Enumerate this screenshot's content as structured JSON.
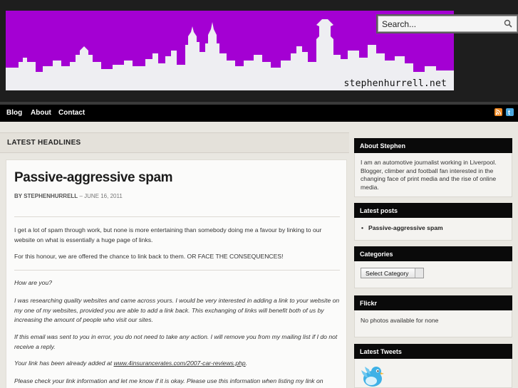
{
  "header": {
    "domain": "stephenhurrell.net",
    "search_placeholder": "Search..."
  },
  "nav": {
    "items": [
      "Blog",
      "About",
      "Contact"
    ]
  },
  "main": {
    "section_title": "LATEST HEADLINES",
    "post": {
      "title": "Passive-aggressive spam",
      "meta_by": "BY STEPHENHURRELL",
      "meta_date": "– JUNE 16, 2011",
      "paragraphs": [
        "I get a lot of spam through work, but none is more entertaining than somebody doing me a favour by linking to our website on what is essentially a huge page of links.",
        "For this honour, we are offered the chance to link back to them. OR FACE THE CONSEQUENCES!"
      ],
      "quote": [
        "How are you?",
        "I was researching quality websites and came across yours. I would be very interested in adding a link to your website on my one of my websites, provided you are able to add a link back. This exchanging of links will benefit both of us by increasing the amount of people who visit our sites.",
        "If this email was sent to you in error, you do not need to take any action. I will remove you from my mailing list if I do not receive a reply.",
        "Please check your link information and let me know if it is okay. Please use this information when listing my link on"
      ],
      "link_line_prefix": "Your link has been already added at ",
      "link_url": "www.4insurancerates.com/2007-car-reviews.php",
      "link_line_suffix": "."
    }
  },
  "sidebar": {
    "about": {
      "title": "About Stephen",
      "text": "I am an automotive journalist working in Liverpool. Blogger, climber and football fan interested in the changing face of print media and the rise of online media."
    },
    "latest_posts": {
      "title": "Latest posts",
      "items": [
        "Passive-aggressive spam"
      ]
    },
    "categories": {
      "title": "Categories",
      "selected": "Select Category"
    },
    "flickr": {
      "title": "Flickr",
      "text": "No photos available for none"
    },
    "tweets": {
      "title": "Latest Tweets"
    }
  },
  "colors": {
    "banner": "#a400d3",
    "header_bg": "#1e1e1e",
    "nav_bg": "#000000",
    "page_bg": "#e9e7e1"
  },
  "icons": [
    "search-icon",
    "rss-icon",
    "twitter-icon",
    "twitter-bird-icon"
  ]
}
